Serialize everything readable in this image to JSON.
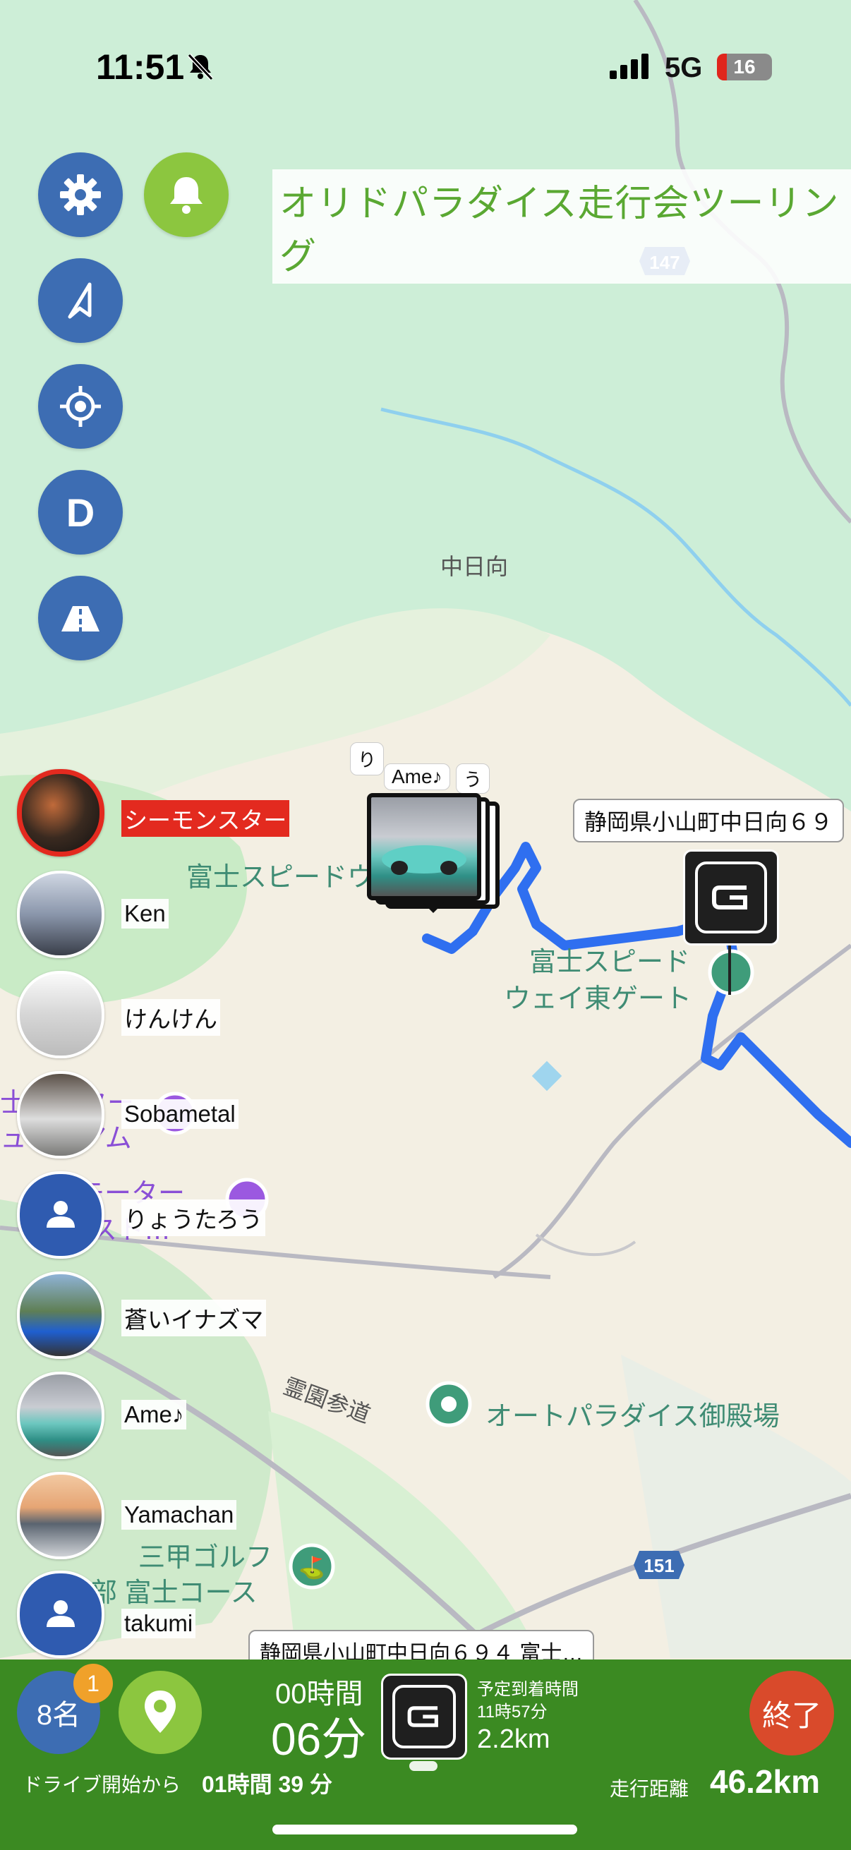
{
  "status_bar": {
    "time": "11:51",
    "network": "5G",
    "battery": "16"
  },
  "title": "オリドパラダイス走行会ツーリング",
  "controls": {
    "d_button": "D"
  },
  "map": {
    "labels": {
      "area_nakahinata": "中日向",
      "speedway": "富士スピードウ",
      "east_gate_1": "富士スピード",
      "east_gate_2": "ウェイ東ゲート",
      "autoparadise": "オートパラダイス御殿場",
      "reien_sando": "霊園参道",
      "golf_1": "三甲ゴルフ",
      "golf_2": "部 富士コース",
      "museum_1": "士モーター",
      "museum_2": "ュージアム",
      "motor_rest_1": "モーター",
      "motor_rest_2": "レスト…"
    },
    "route_shields": [
      "147",
      "151"
    ],
    "cluster_labels": [
      "り",
      "Ame♪",
      "う"
    ],
    "destination_label": "静岡県小山町中日向６９",
    "bottom_address": "静岡県小山町中日向６９４ 富士…"
  },
  "members": [
    {
      "name": "シーモンスター",
      "highlight": true
    },
    {
      "name": "Ken"
    },
    {
      "name": "けんけん"
    },
    {
      "name": "Sobametal"
    },
    {
      "name": "りょうたろう"
    },
    {
      "name": "蒼いイナズマ"
    },
    {
      "name": "Ame♪"
    },
    {
      "name": "Yamachan"
    },
    {
      "name": "takumi"
    }
  ],
  "bottom_bar": {
    "member_count": "8名",
    "badge": "1",
    "elapsed_hours": "00時間",
    "elapsed_minutes": "06分",
    "eta_label": "予定到着時間",
    "eta_time": "11時57分",
    "remaining_distance": "2.2km",
    "end_label": "終了",
    "since_start_label": "ドライブ開始から",
    "since_start_value": "01時間 39 分",
    "distance_label": "走行距離",
    "distance_value": "46.2km"
  },
  "colors": {
    "accent_blue": "#3d6db3",
    "accent_green": "#8cc63f",
    "bottom_green": "#3b8a22",
    "end_red": "#d94a2b",
    "route_blue": "#2f6ff0"
  }
}
